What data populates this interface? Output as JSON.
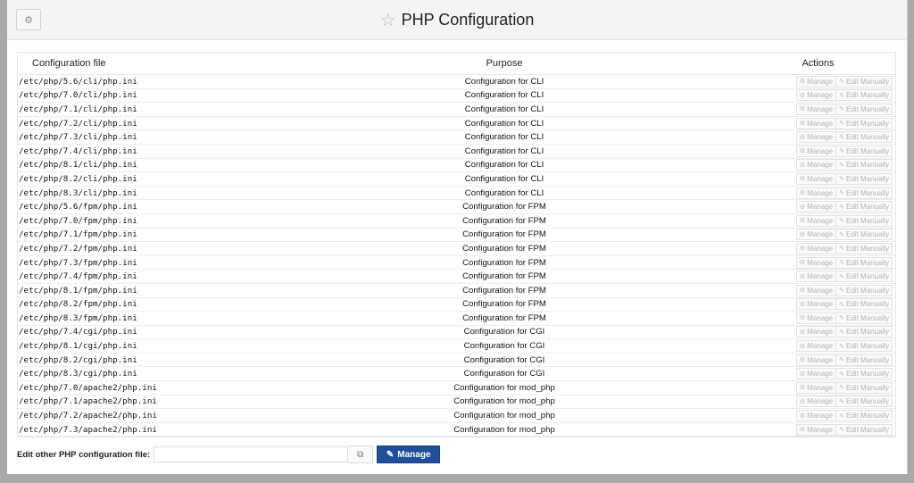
{
  "header": {
    "title": "PHP Configuration",
    "settings_icon": "gear-icon",
    "favorite_icon": "star-outline-icon"
  },
  "table": {
    "columns": [
      "Configuration file",
      "Purpose",
      "Actions"
    ],
    "action_labels": {
      "manage": "Manage",
      "edit": "Edit Manually"
    },
    "rows": [
      {
        "file": "/etc/php/5.6/cli/php.ini",
        "purpose": "Configuration for CLI"
      },
      {
        "file": "/etc/php/7.0/cli/php.ini",
        "purpose": "Configuration for CLI"
      },
      {
        "file": "/etc/php/7.1/cli/php.ini",
        "purpose": "Configuration for CLI"
      },
      {
        "file": "/etc/php/7.2/cli/php.ini",
        "purpose": "Configuration for CLI"
      },
      {
        "file": "/etc/php/7.3/cli/php.ini",
        "purpose": "Configuration for CLI"
      },
      {
        "file": "/etc/php/7.4/cli/php.ini",
        "purpose": "Configuration for CLI"
      },
      {
        "file": "/etc/php/8.1/cli/php.ini",
        "purpose": "Configuration for CLI"
      },
      {
        "file": "/etc/php/8.2/cli/php.ini",
        "purpose": "Configuration for CLI"
      },
      {
        "file": "/etc/php/8.3/cli/php.ini",
        "purpose": "Configuration for CLI"
      },
      {
        "file": "/etc/php/5.6/fpm/php.ini",
        "purpose": "Configuration for FPM"
      },
      {
        "file": "/etc/php/7.0/fpm/php.ini",
        "purpose": "Configuration for FPM"
      },
      {
        "file": "/etc/php/7.1/fpm/php.ini",
        "purpose": "Configuration for FPM"
      },
      {
        "file": "/etc/php/7.2/fpm/php.ini",
        "purpose": "Configuration for FPM"
      },
      {
        "file": "/etc/php/7.3/fpm/php.ini",
        "purpose": "Configuration for FPM"
      },
      {
        "file": "/etc/php/7.4/fpm/php.ini",
        "purpose": "Configuration for FPM"
      },
      {
        "file": "/etc/php/8.1/fpm/php.ini",
        "purpose": "Configuration for FPM"
      },
      {
        "file": "/etc/php/8.2/fpm/php.ini",
        "purpose": "Configuration for FPM"
      },
      {
        "file": "/etc/php/8.3/fpm/php.ini",
        "purpose": "Configuration for FPM"
      },
      {
        "file": "/etc/php/7.4/cgi/php.ini",
        "purpose": "Configuration for CGI"
      },
      {
        "file": "/etc/php/8.1/cgi/php.ini",
        "purpose": "Configuration for CGI"
      },
      {
        "file": "/etc/php/8.2/cgi/php.ini",
        "purpose": "Configuration for CGI"
      },
      {
        "file": "/etc/php/8.3/cgi/php.ini",
        "purpose": "Configuration for CGI"
      },
      {
        "file": "/etc/php/7.0/apache2/php.ini",
        "purpose": "Configuration for mod_php"
      },
      {
        "file": "/etc/php/7.1/apache2/php.ini",
        "purpose": "Configuration for mod_php"
      },
      {
        "file": "/etc/php/7.2/apache2/php.ini",
        "purpose": "Configuration for mod_php"
      },
      {
        "file": "/etc/php/7.3/apache2/php.ini",
        "purpose": "Configuration for mod_php"
      }
    ]
  },
  "footer": {
    "label": "Edit other PHP configuration file:",
    "input_value": "",
    "browse_icon": "file-browse-icon",
    "manage_label": "Manage",
    "manage_icon": "edit-icon"
  },
  "colors": {
    "page_background": "#a9a9a9",
    "header_background": "#f4f4f4",
    "primary_button": "#1f4f9a"
  }
}
